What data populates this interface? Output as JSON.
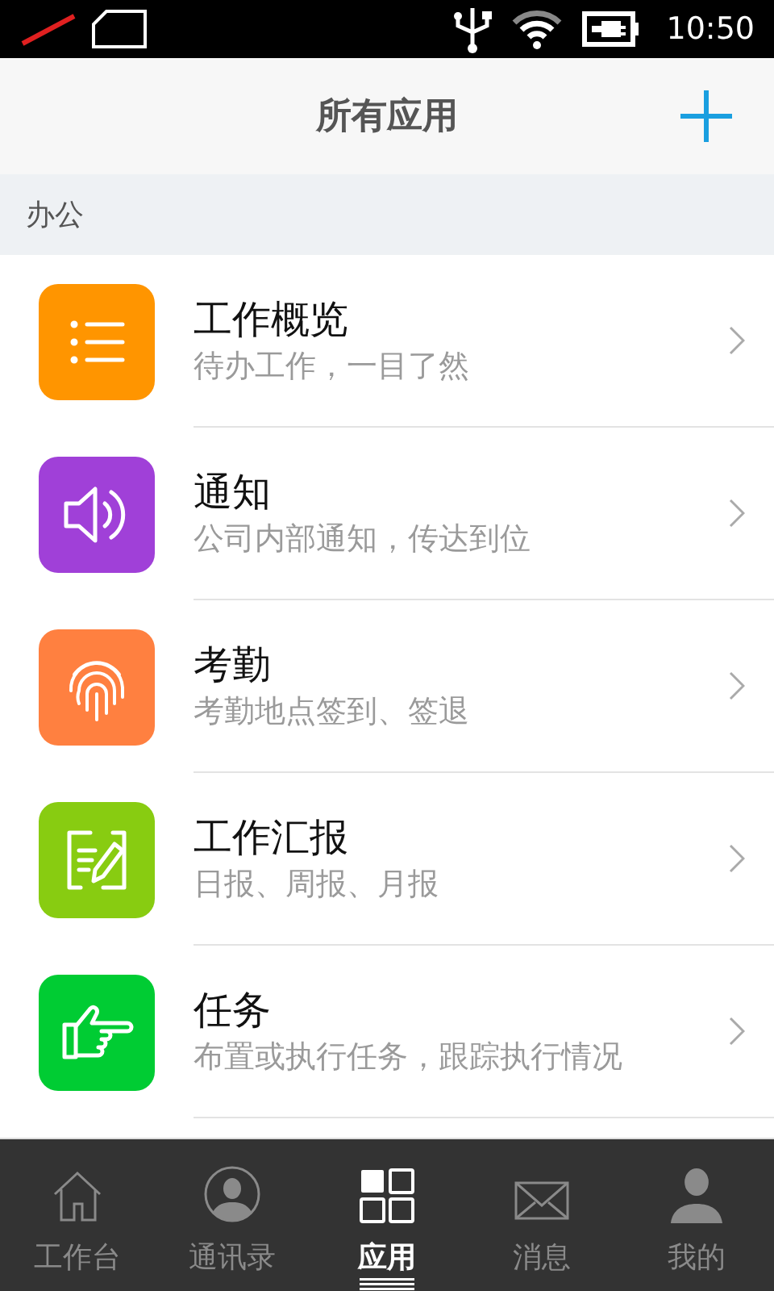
{
  "status_bar": {
    "time": "10:50"
  },
  "header": {
    "title": "所有应用"
  },
  "section": {
    "title": "办公"
  },
  "apps": [
    {
      "kind": "list",
      "color": "#ff9500",
      "title": "工作概览",
      "subtitle": "待办工作，一目了然"
    },
    {
      "kind": "speaker",
      "color": "#a040d8",
      "title": "通知",
      "subtitle": "公司内部通知，传达到位"
    },
    {
      "kind": "fingerprint",
      "color": "#ff8040",
      "title": "考勤",
      "subtitle": "考勤地点签到、签退"
    },
    {
      "kind": "report",
      "color": "#88cc11",
      "title": "工作汇报",
      "subtitle": "日报、周报、月报"
    },
    {
      "kind": "hand",
      "color": "#00cc33",
      "title": "任务",
      "subtitle": "布置或执行任务，跟踪执行情况"
    }
  ],
  "nav": [
    {
      "kind": "home",
      "label": "工作台",
      "selected": false
    },
    {
      "kind": "contacts",
      "label": "通讯录",
      "selected": false
    },
    {
      "kind": "apps",
      "label": "应用",
      "selected": true
    },
    {
      "kind": "messages",
      "label": "消息",
      "selected": false
    },
    {
      "kind": "me",
      "label": "我的",
      "selected": false
    }
  ]
}
